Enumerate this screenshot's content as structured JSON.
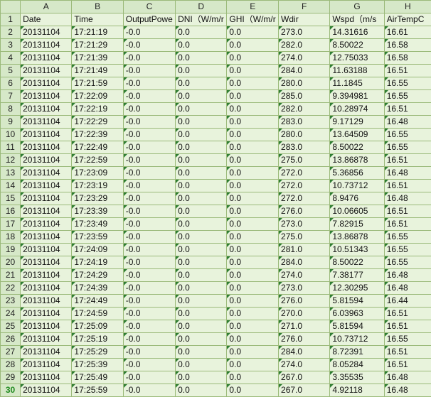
{
  "columns": [
    "A",
    "B",
    "C",
    "D",
    "E",
    "F",
    "G",
    "H"
  ],
  "header_row": [
    "Date",
    "Time",
    "OutputPowe",
    "DNI（W/m/r",
    "GHI（W/m/r",
    "Wdir",
    "Wspd（m/s",
    "AirTempC"
  ],
  "rows": [
    [
      "20131104",
      "17:21:19",
      "-0.0",
      "0.0",
      "0.0",
      "273.0",
      "14.31616",
      "16.61"
    ],
    [
      "20131104",
      "17:21:29",
      "-0.0",
      "0.0",
      "0.0",
      "282.0",
      "8.50022",
      "16.58"
    ],
    [
      "20131104",
      "17:21:39",
      "-0.0",
      "0.0",
      "0.0",
      "274.0",
      "12.75033",
      "16.58"
    ],
    [
      "20131104",
      "17:21:49",
      "-0.0",
      "0.0",
      "0.0",
      "284.0",
      "11.63188",
      "16.51"
    ],
    [
      "20131104",
      "17:21:59",
      "-0.0",
      "0.0",
      "0.0",
      "280.0",
      "11.1845",
      "16.55"
    ],
    [
      "20131104",
      "17:22:09",
      "-0.0",
      "0.0",
      "0.0",
      "285.0",
      "9.394981",
      "16.55"
    ],
    [
      "20131104",
      "17:22:19",
      "-0.0",
      "0.0",
      "0.0",
      "282.0",
      "10.28974",
      "16.51"
    ],
    [
      "20131104",
      "17:22:29",
      "-0.0",
      "0.0",
      "0.0",
      "283.0",
      "9.17129",
      "16.48"
    ],
    [
      "20131104",
      "17:22:39",
      "-0.0",
      "0.0",
      "0.0",
      "280.0",
      "13.64509",
      "16.55"
    ],
    [
      "20131104",
      "17:22:49",
      "-0.0",
      "0.0",
      "0.0",
      "283.0",
      "8.50022",
      "16.55"
    ],
    [
      "20131104",
      "17:22:59",
      "-0.0",
      "0.0",
      "0.0",
      "275.0",
      "13.86878",
      "16.51"
    ],
    [
      "20131104",
      "17:23:09",
      "-0.0",
      "0.0",
      "0.0",
      "272.0",
      "5.36856",
      "16.48"
    ],
    [
      "20131104",
      "17:23:19",
      "-0.0",
      "0.0",
      "0.0",
      "272.0",
      "10.73712",
      "16.51"
    ],
    [
      "20131104",
      "17:23:29",
      "-0.0",
      "0.0",
      "0.0",
      "272.0",
      "8.9476",
      "16.48"
    ],
    [
      "20131104",
      "17:23:39",
      "-0.0",
      "0.0",
      "0.0",
      "276.0",
      "10.06605",
      "16.51"
    ],
    [
      "20131104",
      "17:23:49",
      "-0.0",
      "0.0",
      "0.0",
      "273.0",
      "7.82915",
      "16.51"
    ],
    [
      "20131104",
      "17:23:59",
      "-0.0",
      "0.0",
      "0.0",
      "275.0",
      "13.86878",
      "16.55"
    ],
    [
      "20131104",
      "17:24:09",
      "-0.0",
      "0.0",
      "0.0",
      "281.0",
      "10.51343",
      "16.55"
    ],
    [
      "20131104",
      "17:24:19",
      "-0.0",
      "0.0",
      "0.0",
      "284.0",
      "8.50022",
      "16.55"
    ],
    [
      "20131104",
      "17:24:29",
      "-0.0",
      "0.0",
      "0.0",
      "274.0",
      "7.38177",
      "16.48"
    ],
    [
      "20131104",
      "17:24:39",
      "-0.0",
      "0.0",
      "0.0",
      "273.0",
      "12.30295",
      "16.48"
    ],
    [
      "20131104",
      "17:24:49",
      "-0.0",
      "0.0",
      "0.0",
      "276.0",
      "5.81594",
      "16.44"
    ],
    [
      "20131104",
      "17:24:59",
      "-0.0",
      "0.0",
      "0.0",
      "270.0",
      "6.03963",
      "16.51"
    ],
    [
      "20131104",
      "17:25:09",
      "-0.0",
      "0.0",
      "0.0",
      "271.0",
      "5.81594",
      "16.51"
    ],
    [
      "20131104",
      "17:25:19",
      "-0.0",
      "0.0",
      "0.0",
      "276.0",
      "10.73712",
      "16.55"
    ],
    [
      "20131104",
      "17:25:29",
      "-0.0",
      "0.0",
      "0.0",
      "284.0",
      "8.72391",
      "16.51"
    ],
    [
      "20131104",
      "17:25:39",
      "-0.0",
      "0.0",
      "0.0",
      "274.0",
      "8.05284",
      "16.51"
    ],
    [
      "20131104",
      "17:25:49",
      "-0.0",
      "0.0",
      "0.0",
      "267.0",
      "3.35535",
      "16.48"
    ],
    [
      "20131104",
      "17:25:59",
      "-0.0",
      "0.0",
      "0.0",
      "267.0",
      "4.92118",
      "16.48"
    ]
  ],
  "selected_row": 30
}
